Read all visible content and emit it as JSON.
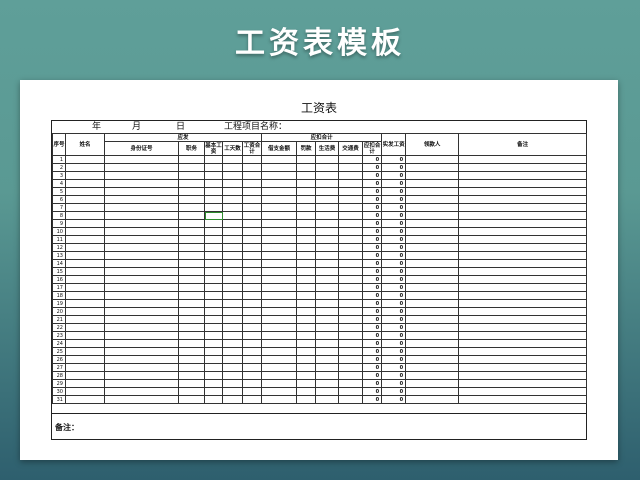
{
  "banner": {
    "title": "工资表模板"
  },
  "document": {
    "title": "工资表",
    "date_line": {
      "year": "年",
      "month": "月",
      "day": "日"
    },
    "project_label": "工程项目名称：",
    "group_headers": {
      "should_pay": "应发",
      "deductions": "应扣合计"
    },
    "columns": [
      "序号",
      "姓名",
      "身份证号",
      "职务",
      "基本工资",
      "工天数",
      "工资合计",
      "借支金额",
      "罚款",
      "生活费",
      "交通费",
      "应扣合计",
      "实发工资",
      "领款人",
      "备注"
    ],
    "rows": [
      {
        "no": "1",
        "deduct": "0",
        "net": "0"
      },
      {
        "no": "2",
        "deduct": "0",
        "net": "0"
      },
      {
        "no": "3",
        "deduct": "0",
        "net": "0"
      },
      {
        "no": "4",
        "deduct": "0",
        "net": "0"
      },
      {
        "no": "5",
        "deduct": "0",
        "net": "0"
      },
      {
        "no": "6",
        "deduct": "0",
        "net": "0"
      },
      {
        "no": "7",
        "deduct": "0",
        "net": "0"
      },
      {
        "no": "8",
        "deduct": "0",
        "net": "0"
      },
      {
        "no": "9",
        "deduct": "0",
        "net": "0"
      },
      {
        "no": "10",
        "deduct": "0",
        "net": "0"
      },
      {
        "no": "11",
        "deduct": "0",
        "net": "0"
      },
      {
        "no": "12",
        "deduct": "0",
        "net": "0"
      },
      {
        "no": "13",
        "deduct": "0",
        "net": "0"
      },
      {
        "no": "14",
        "deduct": "0",
        "net": "0"
      },
      {
        "no": "15",
        "deduct": "0",
        "net": "0"
      },
      {
        "no": "16",
        "deduct": "0",
        "net": "0"
      },
      {
        "no": "17",
        "deduct": "0",
        "net": "0"
      },
      {
        "no": "18",
        "deduct": "0",
        "net": "0"
      },
      {
        "no": "19",
        "deduct": "0",
        "net": "0"
      },
      {
        "no": "20",
        "deduct": "0",
        "net": "0"
      },
      {
        "no": "21",
        "deduct": "0",
        "net": "0"
      },
      {
        "no": "22",
        "deduct": "0",
        "net": "0"
      },
      {
        "no": "23",
        "deduct": "0",
        "net": "0"
      },
      {
        "no": "24",
        "deduct": "0",
        "net": "0"
      },
      {
        "no": "25",
        "deduct": "0",
        "net": "0"
      },
      {
        "no": "26",
        "deduct": "0",
        "net": "0"
      },
      {
        "no": "27",
        "deduct": "0",
        "net": "0"
      },
      {
        "no": "28",
        "deduct": "0",
        "net": "0"
      },
      {
        "no": "29",
        "deduct": "0",
        "net": "0"
      },
      {
        "no": "30",
        "deduct": "0",
        "net": "0"
      },
      {
        "no": "31",
        "deduct": "0",
        "net": "0"
      }
    ],
    "notes_label": "备注："
  },
  "colors": {
    "selection": "#2e8b2e",
    "banner_text": "#ffffff"
  }
}
